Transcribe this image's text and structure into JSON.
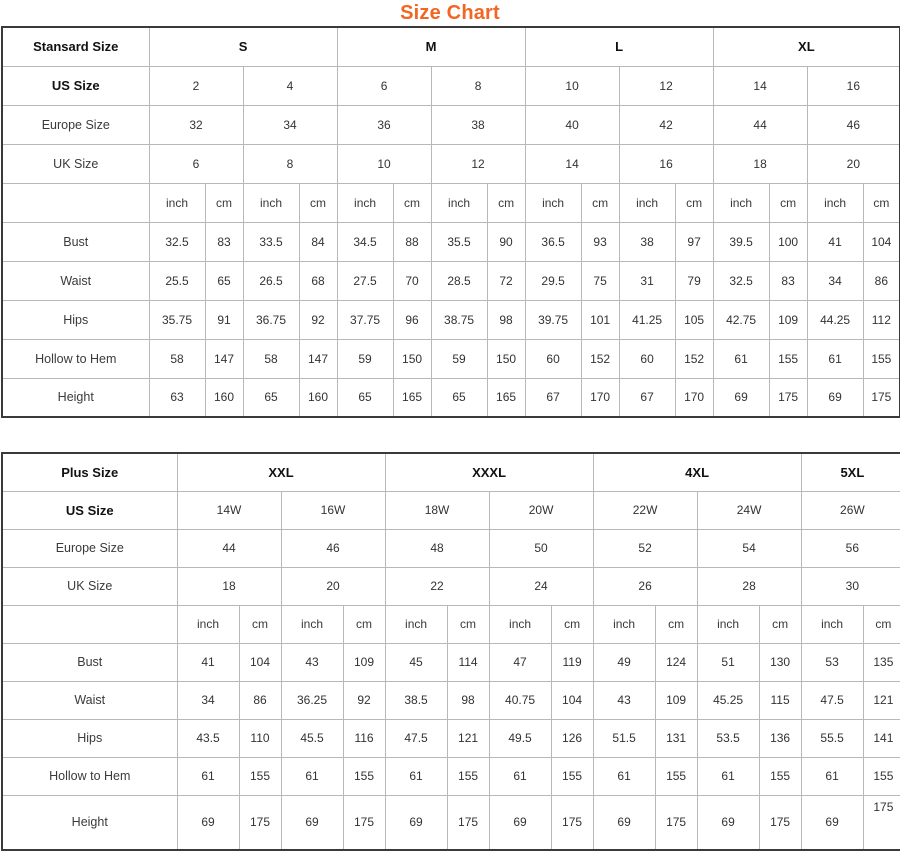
{
  "title": "Size Chart",
  "tables": [
    {
      "id": "standard-size-table",
      "corner_label": "Stansard Size",
      "size_groups": [
        "S",
        "M",
        "L",
        "XL"
      ],
      "rows": [
        {
          "label": "US Size",
          "values": [
            "2",
            "4",
            "6",
            "8",
            "10",
            "12",
            "14",
            "16"
          ]
        },
        {
          "label": "Europe Size",
          "values": [
            "32",
            "34",
            "36",
            "38",
            "40",
            "42",
            "44",
            "46"
          ]
        },
        {
          "label": "UK Size",
          "values": [
            "6",
            "8",
            "10",
            "12",
            "14",
            "16",
            "18",
            "20"
          ]
        }
      ],
      "unit_row": {
        "label": "",
        "units": [
          "inch",
          "cm",
          "inch",
          "cm",
          "inch",
          "cm",
          "inch",
          "cm",
          "inch",
          "cm",
          "inch",
          "cm",
          "inch",
          "cm",
          "inch",
          "cm"
        ]
      },
      "measure_rows": [
        {
          "label": "Bust",
          "values": [
            "32.5",
            "83",
            "33.5",
            "84",
            "34.5",
            "88",
            "35.5",
            "90",
            "36.5",
            "93",
            "38",
            "97",
            "39.5",
            "100",
            "41",
            "104"
          ]
        },
        {
          "label": "Waist",
          "values": [
            "25.5",
            "65",
            "26.5",
            "68",
            "27.5",
            "70",
            "28.5",
            "72",
            "29.5",
            "75",
            "31",
            "79",
            "32.5",
            "83",
            "34",
            "86"
          ]
        },
        {
          "label": "Hips",
          "values": [
            "35.75",
            "91",
            "36.75",
            "92",
            "37.75",
            "96",
            "38.75",
            "98",
            "39.75",
            "101",
            "41.25",
            "105",
            "42.75",
            "109",
            "44.25",
            "112"
          ]
        },
        {
          "label": "Hollow to Hem",
          "values": [
            "58",
            "147",
            "58",
            "147",
            "59",
            "150",
            "59",
            "150",
            "60",
            "152",
            "60",
            "152",
            "61",
            "155",
            "61",
            "155"
          ]
        },
        {
          "label": "Height",
          "values": [
            "63",
            "160",
            "65",
            "160",
            "65",
            "165",
            "65",
            "165",
            "67",
            "170",
            "67",
            "170",
            "69",
            "175",
            "69",
            "175"
          ]
        }
      ]
    },
    {
      "id": "plus-size-table",
      "corner_label": "Plus Size",
      "size_groups": [
        "XXL",
        "XXXL",
        "4XL",
        "5XL"
      ],
      "rows": [
        {
          "label": "US Size",
          "values": [
            "14W",
            "16W",
            "18W",
            "20W",
            "22W",
            "24W",
            "26W"
          ]
        },
        {
          "label": "Europe Size",
          "values": [
            "44",
            "46",
            "48",
            "50",
            "52",
            "54",
            "56"
          ]
        },
        {
          "label": "UK Size",
          "values": [
            "18",
            "20",
            "22",
            "24",
            "26",
            "28",
            "30"
          ]
        }
      ],
      "unit_row": {
        "label": "",
        "units": [
          "inch",
          "cm",
          "inch",
          "cm",
          "inch",
          "cm",
          "inch",
          "cm",
          "inch",
          "cm",
          "inch",
          "cm",
          "inch",
          "cm"
        ]
      },
      "measure_rows": [
        {
          "label": "Bust",
          "values": [
            "41",
            "104",
            "43",
            "109",
            "45",
            "114",
            "47",
            "119",
            "49",
            "124",
            "51",
            "130",
            "53",
            "135"
          ]
        },
        {
          "label": "Waist",
          "values": [
            "34",
            "86",
            "36.25",
            "92",
            "38.5",
            "98",
            "40.75",
            "104",
            "43",
            "109",
            "45.25",
            "115",
            "47.5",
            "121"
          ]
        },
        {
          "label": "Hips",
          "values": [
            "43.5",
            "110",
            "45.5",
            "116",
            "47.5",
            "121",
            "49.5",
            "126",
            "51.5",
            "131",
            "53.5",
            "136",
            "55.5",
            "141"
          ]
        },
        {
          "label": "Hollow to Hem",
          "values": [
            "61",
            "155",
            "61",
            "155",
            "61",
            "155",
            "61",
            "155",
            "61",
            "155",
            "61",
            "155",
            "61",
            "155"
          ]
        },
        {
          "label": "Height",
          "values": [
            "69",
            "175",
            "69",
            "175",
            "69",
            "175",
            "69",
            "175",
            "69",
            "175",
            "69",
            "175",
            "69",
            "175"
          ]
        }
      ]
    }
  ],
  "colors": {
    "title": "#f26522",
    "outer_border": "#3a3a3a",
    "inner_border": "#b8b8b8",
    "text": "#333333",
    "background": "#ffffff"
  }
}
